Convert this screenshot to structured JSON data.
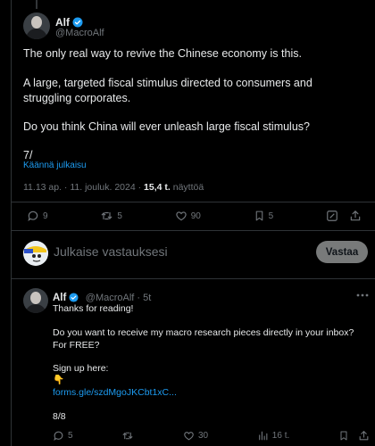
{
  "main_tweet": {
    "name": "Alf",
    "handle": "@MacroAlf",
    "paragraphs": [
      "The only real way to revive the Chinese economy is this.",
      "A large, targeted fiscal stimulus directed to consumers and struggling corporates.",
      "Do you think China will ever unleash large fiscal stimulus?",
      "7/"
    ],
    "translate_label": "Käännä julkaisu",
    "time": "11.13 ap. · 11. jouluk. 2024 · ",
    "views_count": "15,4 t.",
    "views_label": " näyttöä",
    "stats": {
      "replies": "9",
      "reposts": "5",
      "likes": "90",
      "bookmarks": "5"
    }
  },
  "reply_composer": {
    "placeholder": "Julkaise vastauksesi",
    "button_label": "Vastaa"
  },
  "reply_tweet": {
    "name": "Alf",
    "handle": "@MacroAlf · 5t",
    "line1": "Thanks for reading!",
    "line2": "Do you want to receive my macro research pieces directly in your inbox? For FREE?",
    "line3": "Sign up here:",
    "emoji": "👇",
    "link": "forms.gle/szdMgoJKCbt1xC...",
    "line4": "8/8",
    "stats": {
      "replies": "5",
      "likes": "30",
      "views": "16 t."
    }
  },
  "colors": {
    "background": "#000000",
    "accent": "#1d9bf0",
    "muted": "#71767b",
    "text": "#e7e9ea"
  }
}
